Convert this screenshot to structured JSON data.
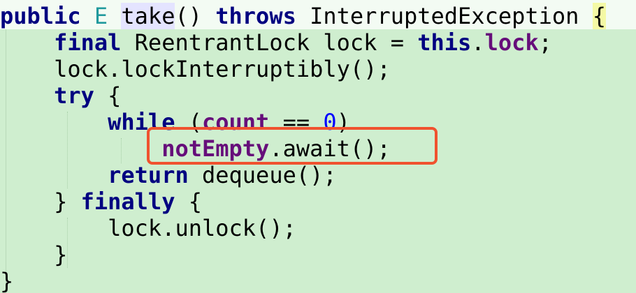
{
  "code": {
    "line0": {
      "kw_public": "public ",
      "type_E": "E",
      "sp": " ",
      "method": "take",
      "rest": "() ",
      "kw_throws": "throws",
      "exception": " InterruptedException ",
      "brace": "{"
    },
    "line1": {
      "indent": "    ",
      "kw_final": "final",
      "mid": " ReentrantLock lock = ",
      "kw_this": "this",
      "dot": ".",
      "field": "lock",
      "semi": ";"
    },
    "line2": {
      "text": "    lock.lockInterruptibly();"
    },
    "line3": {
      "indent": "    ",
      "kw_try": "try",
      "rest": " {"
    },
    "line4": {
      "indent": "        ",
      "kw_while": "while",
      "open": " (",
      "field": "count",
      "op": " == ",
      "num": "0",
      "close": ")"
    },
    "line5": {
      "indent": "            ",
      "field": "notEmpty",
      "rest": ".await();"
    },
    "line6": {
      "indent": "        ",
      "kw_return": "return",
      "rest": " dequeue();"
    },
    "line7": {
      "indent": "    ",
      "close": "} ",
      "kw_finally": "finally",
      "rest": " {"
    },
    "line8": {
      "text": "        lock.unlock();"
    },
    "line9": {
      "text": "    }"
    },
    "line10": {
      "text": "}"
    }
  },
  "colors": {
    "background": "#cfeecf",
    "keyword": "#000080",
    "field": "#660e7a",
    "number": "#0000ff",
    "highlight_box": "#f0522f"
  }
}
